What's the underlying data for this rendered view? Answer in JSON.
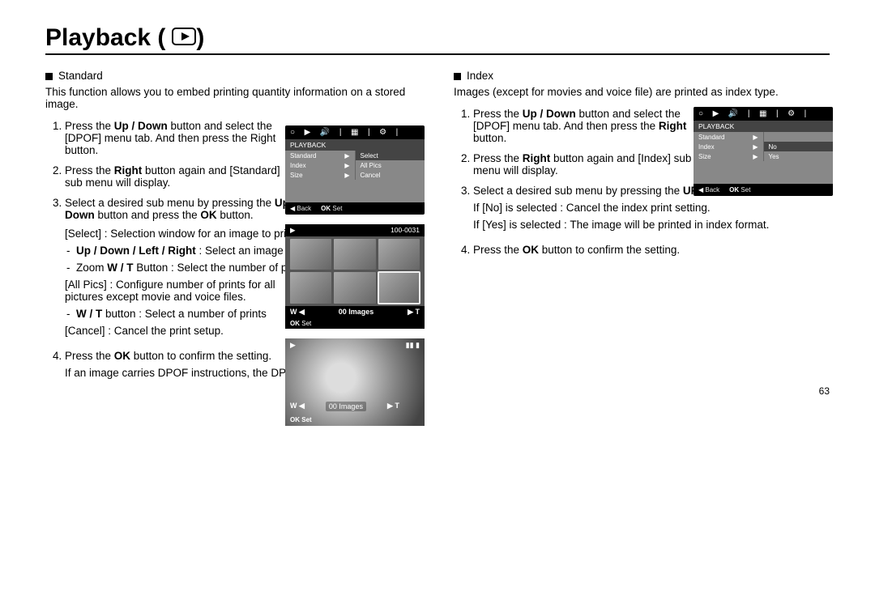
{
  "page_num": "63",
  "title": "Playback (",
  "left": {
    "label": "Standard",
    "intro": "This function allows you to embed printing quantity information on a stored image.",
    "step1": "Press the <b>Up / Down</b> button and select the [DPOF] menu tab. And then press the Right button.",
    "step2": "Press the <b>Right</b> button again and [Standard] sub menu will display.",
    "step3": "Select a desired sub menu by pressing the <b>Up / Down</b> button and press the <b>OK</b> button.",
    "select_line": "[Select] : Selection window for an image to print is displayed",
    "sub_a": "<b>Up / Down / Left / Right</b> : Select an image to print.",
    "sub_b": "Zoom <b>W / T</b> Button : Select the number of prints.",
    "allpics": "[All Pics] : Configure number of prints for all pictures except movie and voice files.",
    "sub_c": "<b>W / T</b> button : Select a number of prints",
    "cancel": "[Cancel] : Cancel the print setup.",
    "step4a": "Press the <b>OK</b> button to confirm the setting.",
    "step4b": "If an image carries DPOF instructions, the DPOF indicator (<span style='font-size:12px'>&#9654;</span>) will show.",
    "fig_menu": {
      "header": "PLAYBACK",
      "rows": [
        [
          "Standard",
          "Select"
        ],
        [
          "Index",
          "All Pics"
        ],
        [
          "Size",
          "Cancel"
        ]
      ],
      "back": "Back",
      "ok": "OK",
      "set": "Set"
    },
    "fig_grid": {
      "folder": "100-0031",
      "w": "W",
      "t": "T",
      "count": "00 Images",
      "ok": "OK",
      "set": "Set"
    },
    "fig_big": {
      "w": "W",
      "t": "T",
      "count": "00 Images",
      "ok": "OK",
      "set": "Set"
    }
  },
  "right": {
    "label": "Index",
    "intro": "Images (except for movies and voice file) are printed as index type.",
    "step1": "Press the <b>Up / Down</b> button and select the [DPOF] menu tab. And then press the <b>Right</b> button.",
    "step2": "Press the <b>Right</b> button again and [Index] sub menu will display.",
    "step3": "Select a desired sub menu by pressing the <b>UP / DOWN</b> button.",
    "if_no": "If [No] is selected   : Cancel the index print setting.",
    "if_yes": "If [Yes] is selected  : The image will be printed in index format.",
    "step4": "Press the <b>OK</b> button to confirm the setting.",
    "fig_menu": {
      "header": "PLAYBACK",
      "rows": [
        [
          "Standard",
          ""
        ],
        [
          "Index",
          "No"
        ],
        [
          "Size",
          "Yes"
        ]
      ],
      "back": "Back",
      "ok": "OK",
      "set": "Set"
    }
  }
}
